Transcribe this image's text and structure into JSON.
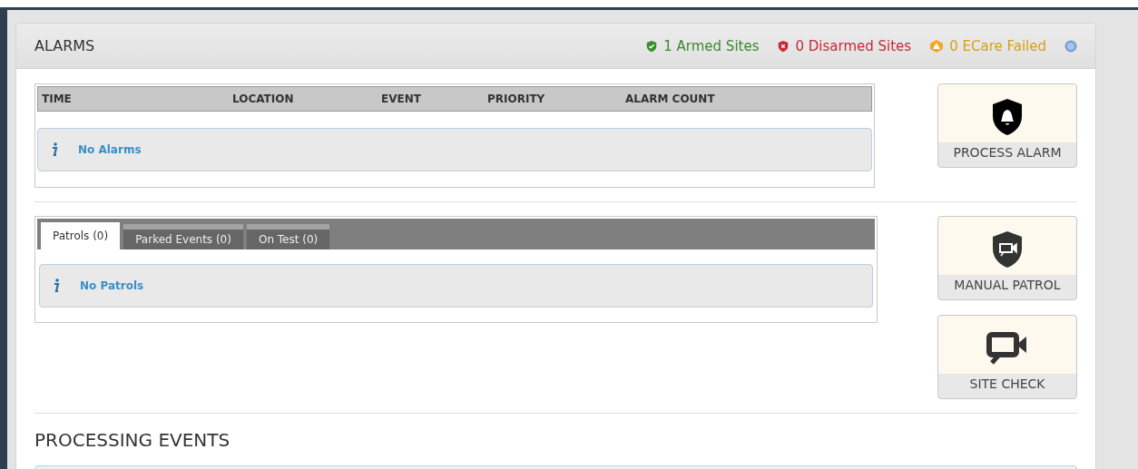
{
  "panel": {
    "title": "ALARMS",
    "status": [
      {
        "kind": "armed",
        "label": "1 Armed Sites",
        "color": "#3a8a2e"
      },
      {
        "kind": "disarmed",
        "label": "0 Disarmed Sites",
        "color": "#c8283a"
      },
      {
        "kind": "failed",
        "label": "0 ECare Failed",
        "color": "#d4a017"
      }
    ]
  },
  "alarms_table": {
    "columns": [
      "TIME",
      "LOCATION",
      "EVENT",
      "PRIORITY",
      "ALARM COUNT"
    ],
    "empty_message": "No Alarms"
  },
  "patrol_tabs": {
    "tabs": [
      {
        "label": "Patrols (0)",
        "selected": true
      },
      {
        "label": "Parked Events (0)",
        "selected": false
      },
      {
        "label": "On Test (0)",
        "selected": false
      }
    ],
    "empty_message": "No Patrols"
  },
  "actions": [
    {
      "kind": "alarm",
      "label": "PROCESS ALARM"
    },
    {
      "kind": "patrol",
      "label": "MANUAL PATROL"
    },
    {
      "kind": "camera",
      "label": "SITE CHECK"
    }
  ],
  "processing": {
    "title": "PROCESSING EVENTS"
  }
}
